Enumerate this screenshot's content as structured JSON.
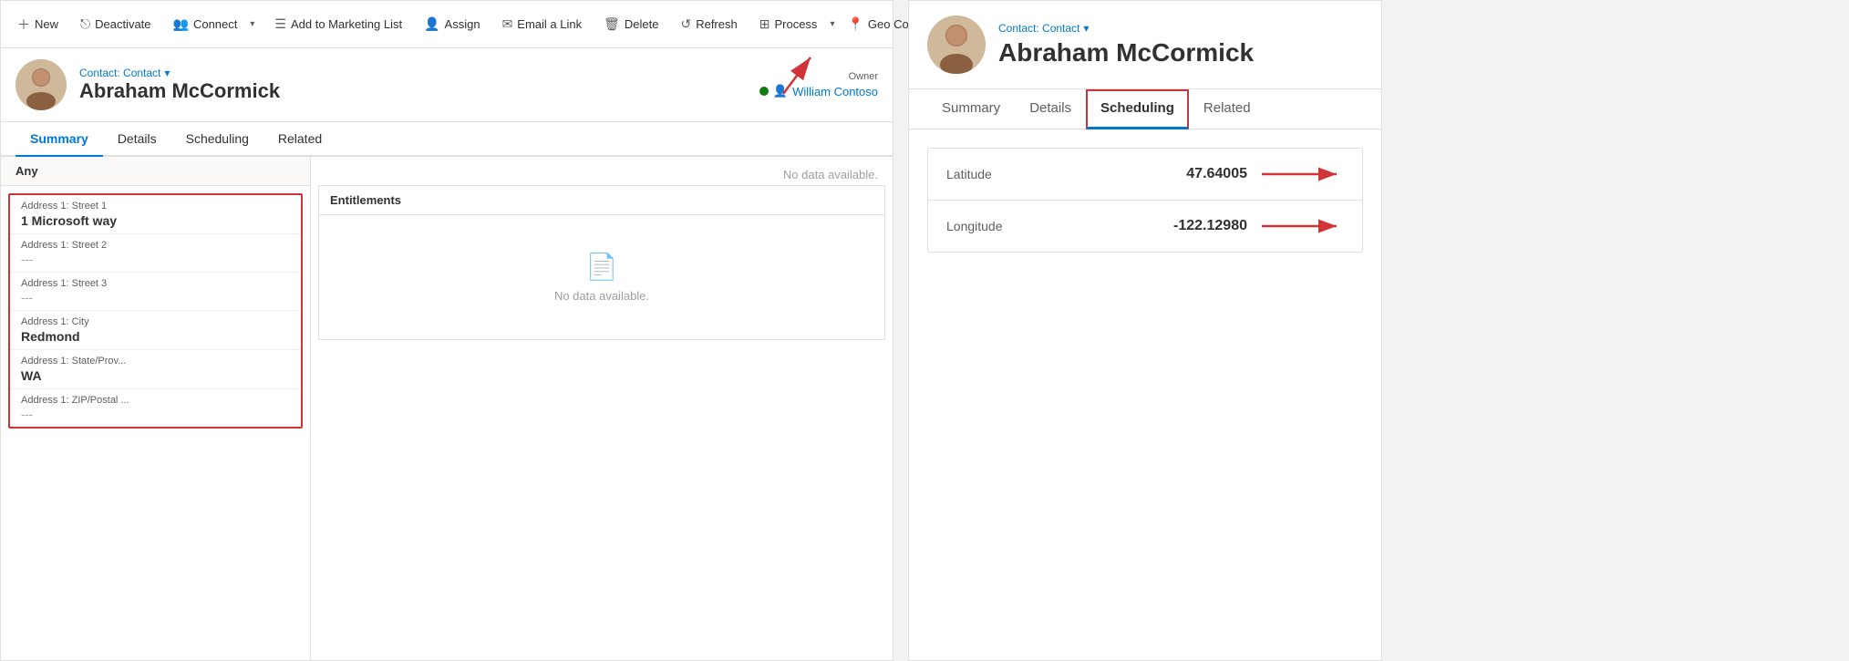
{
  "toolbar": {
    "new_label": "New",
    "deactivate_label": "Deactivate",
    "connect_label": "Connect",
    "add_to_marketing_label": "Add to Marketing List",
    "assign_label": "Assign",
    "email_link_label": "Email a Link",
    "delete_label": "Delete",
    "refresh_label": "Refresh",
    "process_label": "Process",
    "geo_code_label": "Geo Code"
  },
  "contact": {
    "entity_label": "Contact: Contact",
    "name": "Abraham McCormick",
    "owner_label": "Owner",
    "owner_name": "William Contoso"
  },
  "tabs": {
    "items": [
      "Summary",
      "Details",
      "Scheduling",
      "Related"
    ],
    "active": "Summary"
  },
  "form": {
    "section_label": "Any",
    "fields": [
      {
        "label": "Address 1: Street 1",
        "value": "1 Microsoft way",
        "bold": true
      },
      {
        "label": "Address 1: Street 2",
        "value": "---",
        "bold": false
      },
      {
        "label": "Address 1: Street 3",
        "value": "---",
        "bold": false
      },
      {
        "label": "Address 1: City",
        "value": "Redmond",
        "bold": true
      },
      {
        "label": "Address 1: State/Prov...",
        "value": "WA",
        "bold": true
      },
      {
        "label": "Address 1: ZIP/Postal ...",
        "value": "---",
        "bold": false
      }
    ]
  },
  "right_area": {
    "no_data_label": "No data available.",
    "entitlements_label": "Entitlements",
    "entitlements_no_data": "No data available."
  },
  "right_panel": {
    "entity_label": "Contact: Contact",
    "name": "Abraham McCormick",
    "tabs": [
      "Summary",
      "Details",
      "Scheduling",
      "Related"
    ],
    "active_tab": "Scheduling",
    "scheduling": {
      "latitude_label": "Latitude",
      "latitude_value": "47.64005",
      "longitude_label": "Longitude",
      "longitude_value": "-122.12980"
    }
  }
}
